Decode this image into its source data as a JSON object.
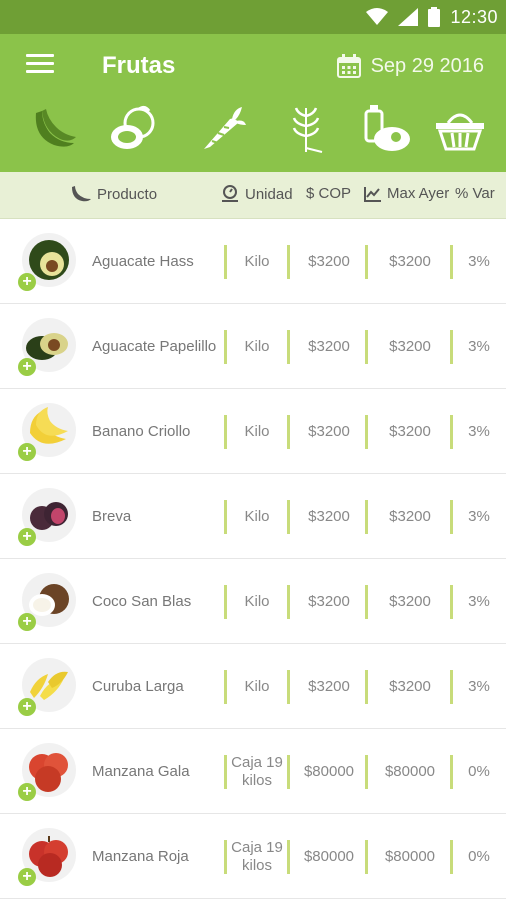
{
  "status": {
    "time": "12:30"
  },
  "app": {
    "title": "Frutas",
    "date": "Sep 29 2016"
  },
  "categories": [
    {
      "name": "frutas",
      "icon": "banana-icon",
      "active": true
    },
    {
      "name": "tuberculos",
      "icon": "coconut-icon",
      "active": false
    },
    {
      "name": "verduras",
      "icon": "carrot-icon",
      "active": false
    },
    {
      "name": "granos",
      "icon": "wheat-icon",
      "active": false
    },
    {
      "name": "carnes-lacteos",
      "icon": "meat-bottle-icon",
      "active": false
    },
    {
      "name": "mercado",
      "icon": "basket-icon",
      "active": false
    }
  ],
  "headers": {
    "product": "Producto",
    "unit": "Unidad",
    "cop": "$ COP",
    "max": "Max Ayer",
    "var": "% Var"
  },
  "products": [
    {
      "name": "Aguacate Hass",
      "unit": "Kilo",
      "price": "$3200",
      "max": "$3200",
      "var": "3%"
    },
    {
      "name": "Aguacate Papelillo",
      "unit": "Kilo",
      "price": "$3200",
      "max": "$3200",
      "var": "3%"
    },
    {
      "name": "Banano Criollo",
      "unit": "Kilo",
      "price": "$3200",
      "max": "$3200",
      "var": "3%"
    },
    {
      "name": "Breva",
      "unit": "Kilo",
      "price": "$3200",
      "max": "$3200",
      "var": "3%"
    },
    {
      "name": "Coco San Blas",
      "unit": "Kilo",
      "price": "$3200",
      "max": "$3200",
      "var": "3%"
    },
    {
      "name": "Curuba Larga",
      "unit": "Kilo",
      "price": "$3200",
      "max": "$3200",
      "var": "3%"
    },
    {
      "name": "Manzana Gala",
      "unit": "Caja 19 kilos",
      "price": "$80000",
      "max": "$80000",
      "var": "0%"
    },
    {
      "name": "Manzana Roja",
      "unit": "Caja 19 kilos",
      "price": "$80000",
      "max": "$80000",
      "var": "0%"
    }
  ],
  "colors": {
    "statusbar": "#6f9f35",
    "appbar": "#8bc34a",
    "header": "#e8f0d6",
    "accent": "#9acd45",
    "active_icon": "#4f7f1f"
  }
}
